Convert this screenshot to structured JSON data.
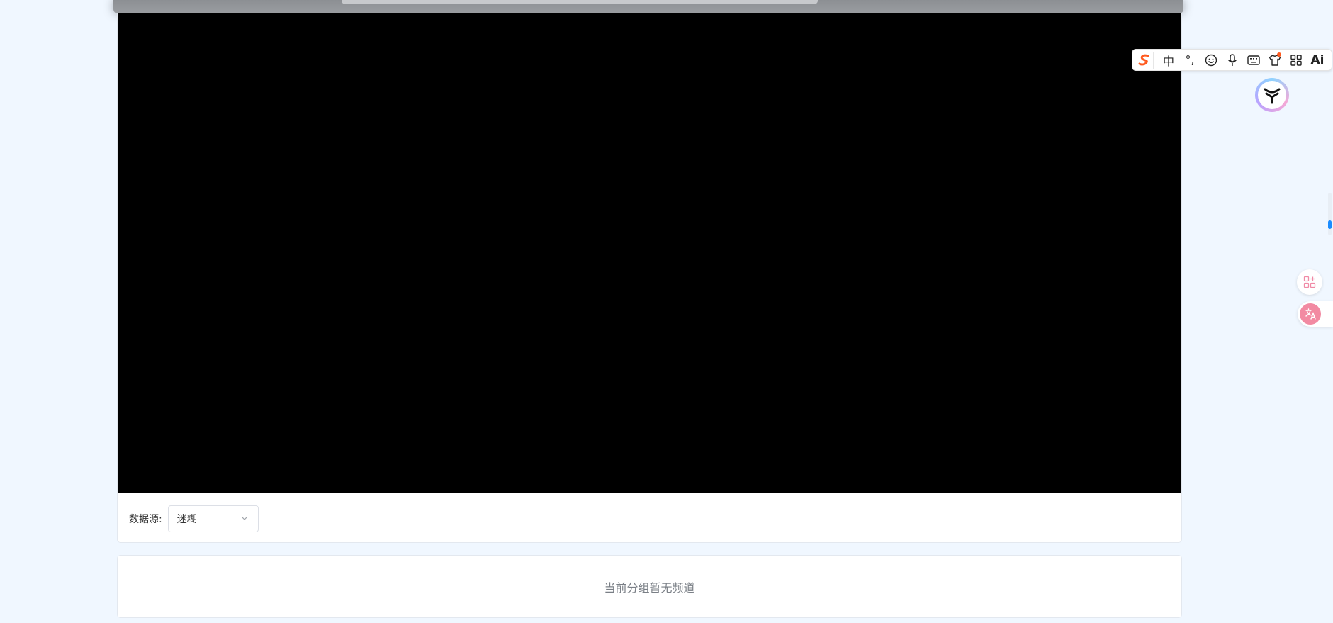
{
  "source": {
    "label": "数据源:",
    "selected": "迷糊"
  },
  "channels": {
    "empty_message": "当前分组暂无频道"
  },
  "ime_toolbar": {
    "buttons": [
      {
        "label": "中",
        "icon": "chinese-mode"
      },
      {
        "label": "°,",
        "icon": "punctuation"
      },
      {
        "label": "☺",
        "icon": "emoji-icon"
      },
      {
        "label": "🎙",
        "icon": "microphone-icon"
      },
      {
        "label": "⌨",
        "icon": "keyboard-icon"
      },
      {
        "label": "👕",
        "icon": "skin-icon"
      },
      {
        "label": "⊞",
        "icon": "toolbox-icon"
      },
      {
        "label": "Ai",
        "icon": "ai-icon"
      }
    ]
  },
  "colors": {
    "page_bg": "#f0f7ff",
    "video_bg": "#000000",
    "ime_accent": "#ff5a1f",
    "scroll_thumb": "#1b8cff",
    "translate_accent": "#f28aa2"
  }
}
